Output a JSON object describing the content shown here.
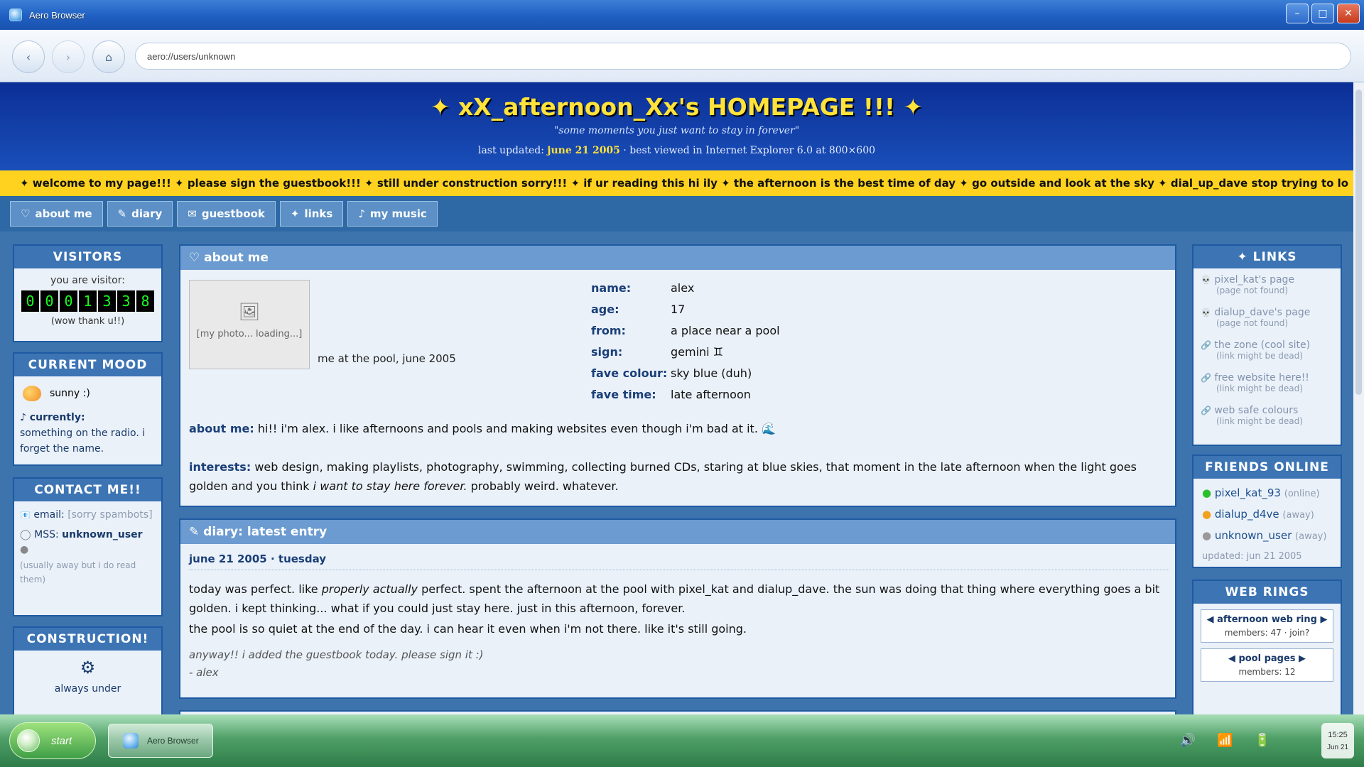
{
  "window": {
    "title": "Aero Browser",
    "min": "–",
    "max": "□",
    "close": "✕"
  },
  "nav": {
    "back": "‹",
    "forward": "›",
    "home": "⌂",
    "url": "aero://users/unknown"
  },
  "header": {
    "title": "✦ xX_afternoon_Xx's HOMEPAGE !!! ✦",
    "quote": "\"some moments you just want to stay in forever\"",
    "updated_label": "last updated:",
    "updated_date": "june 21 2005",
    "updated_suffix": "· best viewed in Internet Explorer 6.0 at 800×600"
  },
  "marquee": "✦ welcome to my page!!! ✦ please sign the guestbook!!! ✦ still under construction sorry!!! ✦ if ur reading this hi ily ✦ the afternoon is the best time of day ✦ go outside and look at the sky ✦ dial_up_dave stop trying to lo",
  "tabs": [
    {
      "icon": "♡",
      "label": "about me"
    },
    {
      "icon": "✎",
      "label": "diary"
    },
    {
      "icon": "✉",
      "label": "guestbook"
    },
    {
      "icon": "✦",
      "label": "links"
    },
    {
      "icon": "♪",
      "label": "my music"
    }
  ],
  "visitors": {
    "title": "VISITORS",
    "label": "you are visitor:",
    "digits": [
      "0",
      "0",
      "0",
      "1",
      "3",
      "3",
      "8"
    ],
    "thanks": "(wow thank u!!)"
  },
  "mood": {
    "title": "CURRENT MOOD",
    "mood": "sunny :)",
    "currently_label": "♪ currently:",
    "currently": "something on the radio. i forget the name."
  },
  "contact": {
    "title": "CONTACT ME!!",
    "email_label": "email:",
    "email_value": "[sorry spambots]",
    "msn_label": "MSS:",
    "msn_value": "unknown_user",
    "note": "(usually away but i do read them)"
  },
  "construction": {
    "title": "CONSTRUCTION!",
    "icon": "⚙",
    "text": "always under"
  },
  "about": {
    "heading": "♡ about me",
    "photo_icon": "🖼",
    "photo_text": "[my photo... loading...]",
    "caption": "me at the pool, june 2005",
    "fields": [
      {
        "k": "name:",
        "v": "alex"
      },
      {
        "k": "age:",
        "v": "17"
      },
      {
        "k": "from:",
        "v": "a place near a pool"
      },
      {
        "k": "sign:",
        "v": "gemini ♊"
      },
      {
        "k": "fave colour:",
        "v": "sky blue (duh)"
      },
      {
        "k": "fave time:",
        "v": "late afternoon"
      }
    ],
    "aboutme_label": "about me:",
    "aboutme_text": "hi!! i'm alex. i like afternoons and pools and making websites even though i'm bad at it. 🌊",
    "interests_label": "interests:",
    "interests_text": "web design, making playlists, photography, swimming, collecting burned CDs, staring at blue skies, that moment in the late afternoon when the light goes golden and you think",
    "interests_italic": "i want to stay here forever.",
    "interests_end": "probably weird. whatever."
  },
  "diary": {
    "heading": "✎ diary: latest entry",
    "date": "june 21 2005",
    "day": "tuesday",
    "p1_a": "today was perfect. like",
    "p1_i": "properly actually",
    "p1_b": "perfect. spent the afternoon at the pool with pixel_kat and dialup_dave. the sun was doing that thing where everything goes a bit golden. i kept thinking... what if you could just stay here. just in this afternoon, forever.",
    "p2": "the pool is so quiet at the end of the day. i can hear it even when i'm not there. like it's still going.",
    "p3": "anyway!! i added the guestbook today. please sign it :)",
    "sign": "- alex"
  },
  "links": {
    "title": "✦ LINKS",
    "items": [
      {
        "icon": "💀",
        "label": "pixel_kat's page",
        "note": "(page not found)"
      },
      {
        "icon": "💀",
        "label": "dialup_dave's page",
        "note": "(page not found)"
      },
      {
        "icon": "🔗",
        "label": "the zone (cool site)",
        "note": "(link might be dead)"
      },
      {
        "icon": "🔗",
        "label": "free website here!!",
        "note": "(link might be dead)"
      },
      {
        "icon": "🔗",
        "label": "web safe colours",
        "note": "(link might be dead)"
      }
    ]
  },
  "friends": {
    "title": "FRIENDS ONLINE",
    "items": [
      {
        "name": "pixel_kat_93",
        "status": "(online)",
        "color": "#2cbf2c"
      },
      {
        "name": "dialup_d4ve",
        "status": "(away)",
        "color": "#f0a21e"
      },
      {
        "name": "unknown_user",
        "status": "(away)",
        "color": "#999999"
      }
    ],
    "updated": "updated: jun 21 2005"
  },
  "webrings": {
    "title": "WEB RINGS",
    "rings": [
      {
        "name": "◀ afternoon web ring ▶",
        "info": "members: 47 · join?"
      },
      {
        "name": "◀ pool pages ▶",
        "info": "members: 12"
      }
    ]
  },
  "taskbar": {
    "start": "start",
    "app": "Aero Browser",
    "volume": "🔊",
    "wifi": "📶",
    "battery": "🔋",
    "time": "15:25",
    "date": "Jun 21"
  }
}
